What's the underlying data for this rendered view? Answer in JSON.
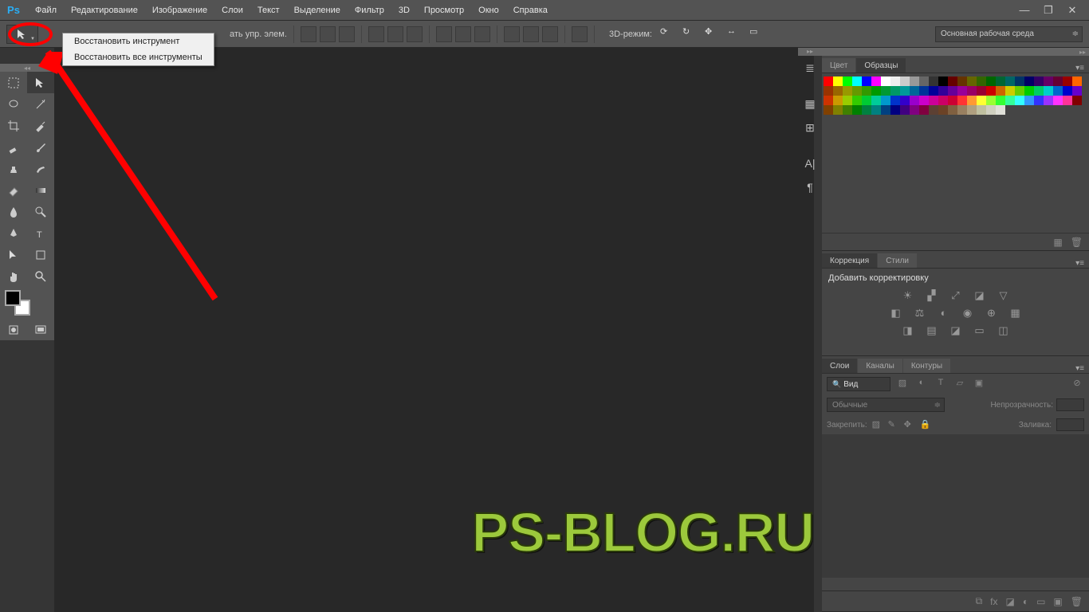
{
  "menubar": {
    "items": [
      "Файл",
      "Редактирование",
      "Изображение",
      "Слои",
      "Текст",
      "Выделение",
      "Фильтр",
      "3D",
      "Просмотр",
      "Окно",
      "Справка"
    ]
  },
  "optionsbar": {
    "fragment": "ать упр. элем.",
    "mode3d_label": "3D-режим:",
    "workspace": "Основная рабочая среда"
  },
  "context_menu": {
    "items": [
      "Восстановить инструмент",
      "Восстановить все инструменты"
    ]
  },
  "panels": {
    "color_tabs": [
      "Цвет",
      "Образцы"
    ],
    "adjustments_tabs": [
      "Коррекция",
      "Стили"
    ],
    "adjustments_title": "Добавить корректировку",
    "layers_tabs": [
      "Слои",
      "Каналы",
      "Контуры"
    ],
    "layers": {
      "filter_kind": "Вид",
      "blend_mode": "Обычные",
      "opacity_label": "Непрозрачность:",
      "lock_label": "Закрепить:",
      "fill_label": "Заливка:"
    }
  },
  "swatch_colors": [
    "#ff0000",
    "#ffff00",
    "#00ff00",
    "#00ffff",
    "#0000ff",
    "#ff00ff",
    "#ffffff",
    "#eeeeee",
    "#cccccc",
    "#999999",
    "#666666",
    "#333333",
    "#000000",
    "#660000",
    "#663300",
    "#666600",
    "#336600",
    "#006600",
    "#006633",
    "#006666",
    "#003366",
    "#000066",
    "#330066",
    "#660066",
    "#660033",
    "#990000",
    "#ff6600",
    "#993300",
    "#996600",
    "#999900",
    "#669900",
    "#339900",
    "#009900",
    "#009933",
    "#009966",
    "#009999",
    "#006699",
    "#003399",
    "#000099",
    "#330099",
    "#660099",
    "#990099",
    "#990066",
    "#990033",
    "#cc0000",
    "#cc6600",
    "#cccc00",
    "#66cc00",
    "#00cc00",
    "#00cc66",
    "#00cccc",
    "#0066cc",
    "#0000cc",
    "#6600cc",
    "#cc3300",
    "#cc9900",
    "#99cc00",
    "#33cc00",
    "#00cc33",
    "#00cc99",
    "#0099cc",
    "#0033cc",
    "#3300cc",
    "#9900cc",
    "#cc00cc",
    "#cc0099",
    "#cc0066",
    "#cc0033",
    "#ff3333",
    "#ff9933",
    "#ffff33",
    "#99ff33",
    "#33ff33",
    "#33ff99",
    "#33ffff",
    "#3399ff",
    "#3333ff",
    "#9933ff",
    "#ff33ff",
    "#ff3399",
    "#800000",
    "#804000",
    "#808000",
    "#408000",
    "#008000",
    "#008040",
    "#008080",
    "#004080",
    "#000080",
    "#400080",
    "#800080",
    "#800040",
    "#5c4033",
    "#6b4226",
    "#806040",
    "#998060",
    "#b0a080",
    "#c0c0a0",
    "#d0d0c0",
    "#e0e0d8"
  ],
  "watermark": "PS-BLOG.RU"
}
